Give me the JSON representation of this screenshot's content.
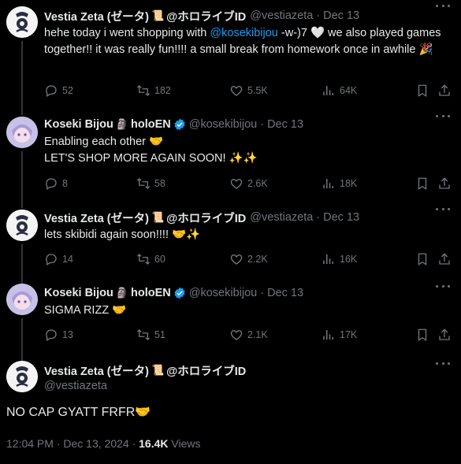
{
  "tweets": [
    {
      "name": "Vestia Zeta (ゼータ)",
      "badge_emoji": "📜",
      "org": "@ホロライブID",
      "handle": "@vestiazeta",
      "dot": "·",
      "date": "Dec 13",
      "text_before": "hehe today i went shopping with ",
      "mention": "@kosekibijou",
      "text_after": " -w-)7 🤍 we also played games together!! it was really fun!!!! a small break from homework once in awhile 🎉",
      "stats": {
        "replies": "52",
        "retweets": "182",
        "likes": "5.5K",
        "views": "64K"
      }
    },
    {
      "name": "Koseki Bijou",
      "badge_emoji": "🗿",
      "org": "holoEN",
      "handle": "@kosekibijou",
      "dot": "·",
      "date": "Dec 13",
      "line1": "Enabling each other 🤝",
      "line2": "LET'S SHOP MORE AGAIN SOON! ✨✨",
      "stats": {
        "replies": "8",
        "retweets": "58",
        "likes": "2.6K",
        "views": "18K"
      }
    },
    {
      "name": "Vestia Zeta (ゼータ)",
      "badge_emoji": "📜",
      "org": "@ホロライブID",
      "handle": "@vestiazeta",
      "dot": "·",
      "date": "Dec 13",
      "text": "lets skibidi again soon!!!! 🤝✨",
      "stats": {
        "replies": "14",
        "retweets": "60",
        "likes": "2.2K",
        "views": "16K"
      }
    },
    {
      "name": "Koseki Bijou",
      "badge_emoji": "🗿",
      "org": "holoEN",
      "handle": "@kosekibijou",
      "dot": "·",
      "date": "Dec 13",
      "text": "SIGMA RIZZ 🤝",
      "stats": {
        "replies": "13",
        "retweets": "51",
        "likes": "2.1K",
        "views": "17K"
      }
    }
  ],
  "main": {
    "name": "Vestia Zeta (ゼータ)",
    "badge_emoji": "📜",
    "org": "@ホロライブID",
    "handle": "@vestiazeta",
    "text": "NO CAP GYATT FRFR🤝",
    "time": "12:04 PM",
    "dot": "·",
    "date": "Dec 13, 2024",
    "views_count": "16.4K",
    "views_label": "Views"
  },
  "colors": {
    "accent": "#1d9bf0",
    "muted": "#71767b",
    "text": "#e7e9ea",
    "background": "#000000"
  },
  "icons": [
    "reply-icon",
    "retweet-icon",
    "like-icon",
    "views-icon",
    "bookmark-icon",
    "share-icon",
    "more-icon",
    "verified-icon"
  ]
}
